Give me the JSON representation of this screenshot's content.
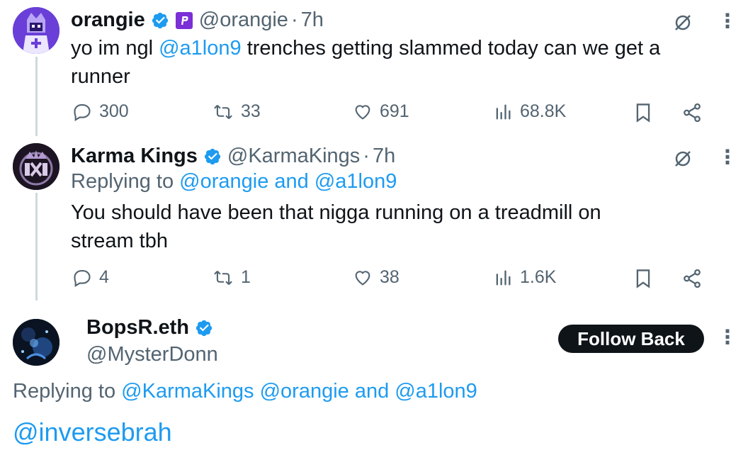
{
  "tweets": [
    {
      "name": "orangie",
      "handle": "@orangie",
      "time": "7h",
      "text_before": "yo im ngl ",
      "mention": "@a1lon9",
      "text_after": " trenches getting slammed today can we get a runner",
      "stats": {
        "replies": "300",
        "reposts": "33",
        "likes": "691",
        "views": "68.8K"
      }
    },
    {
      "name": "Karma Kings",
      "handle": "@KarmaKings",
      "time": "7h",
      "replying_prefix": "Replying to ",
      "replying_to": "@orangie and @a1lon9",
      "text": "You should have been that nigga running on a treadmill on stream tbh",
      "stats": {
        "replies": "4",
        "reposts": "1",
        "likes": "38",
        "views": "1.6K"
      }
    }
  ],
  "main": {
    "name": "BopsR.eth",
    "handle": "@MysterDonn",
    "follow_label": "Follow Back",
    "replying_prefix": "Replying to ",
    "replying_to": "@KarmaKings @orangie and @a1lon9",
    "text": "@inversebrah"
  },
  "colors": {
    "link": "#1d9bf0",
    "verified": "#1d9bf0",
    "muted": "#536471",
    "button": "#0f1419"
  },
  "icons": [
    "verified-icon",
    "affiliate-icon",
    "grok-icon",
    "more-icon",
    "reply-icon",
    "repost-icon",
    "like-icon",
    "views-icon",
    "bookmark-icon",
    "share-icon"
  ]
}
